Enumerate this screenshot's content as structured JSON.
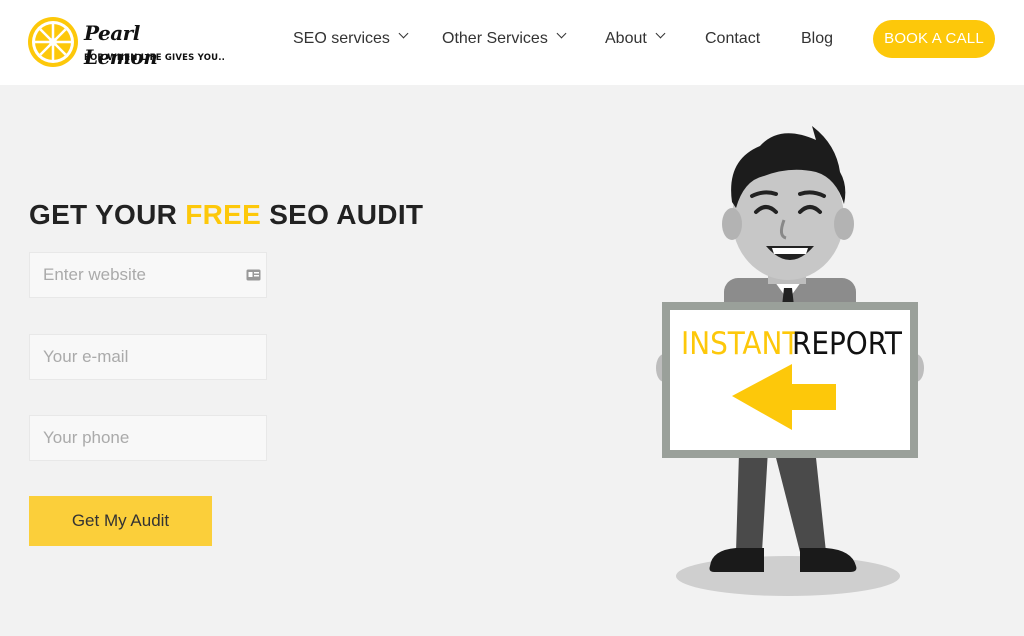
{
  "brand": {
    "name": "Pearl Lemon",
    "tagline": "FOR WHEN LIFE GIVES YOU.."
  },
  "nav": {
    "items": [
      {
        "label": "SEO services",
        "dropdown": true
      },
      {
        "label": "Other Services",
        "dropdown": true
      },
      {
        "label": "About",
        "dropdown": true
      },
      {
        "label": "Contact",
        "dropdown": false
      },
      {
        "label": "Blog",
        "dropdown": false
      }
    ],
    "cta_label": "BOOK A CALL"
  },
  "form": {
    "headline_pre": "GET YOUR ",
    "headline_highlight": "FREE",
    "headline_post": " SEO AUDIT",
    "website_placeholder": "Enter website",
    "email_placeholder": "Your e-mail",
    "phone_placeholder": "Your phone",
    "submit_label": "Get My Audit"
  },
  "illustration": {
    "sign_word1": "INSTANT",
    "sign_word2": "REPORT"
  },
  "colors": {
    "accent": "#fdc80a",
    "background": "#f2f2f2",
    "header": "#ffffff",
    "text": "#222222"
  }
}
